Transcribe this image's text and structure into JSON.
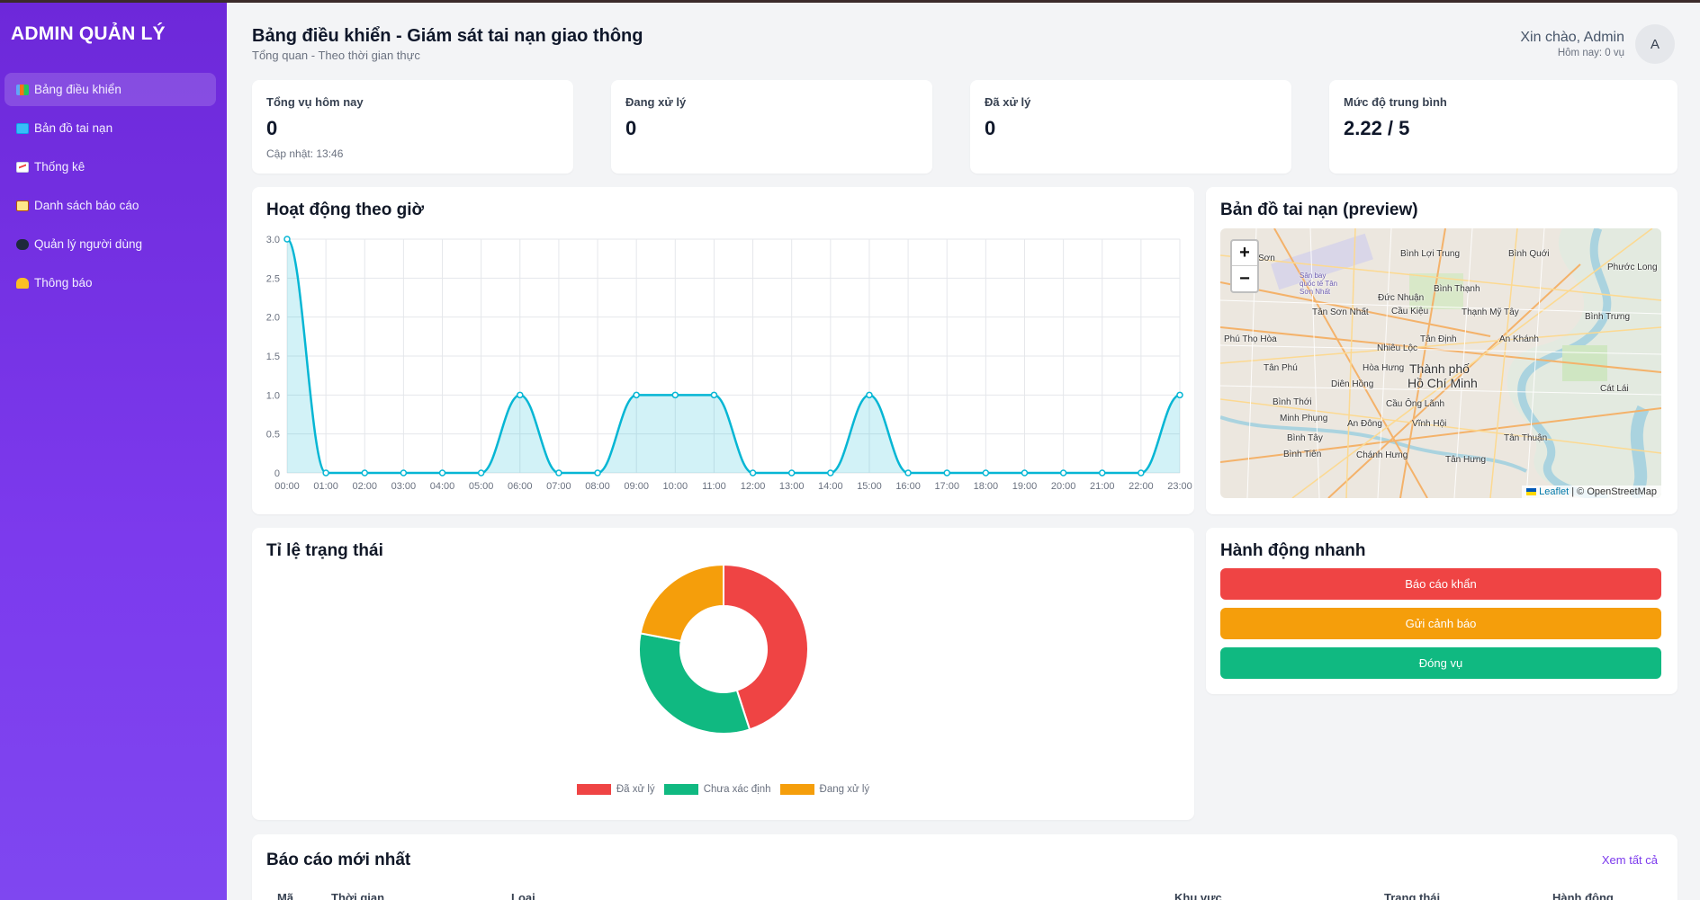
{
  "sidebar": {
    "brand": "ADMIN QUẢN LÝ",
    "items": [
      {
        "label": "Bảng điều khiển",
        "icon": "bar-chart-icon"
      },
      {
        "label": "Bản đồ tai nạn",
        "icon": "map-icon"
      },
      {
        "label": "Thống kê",
        "icon": "line-chart-icon"
      },
      {
        "label": "Danh sách báo cáo",
        "icon": "clipboard-icon"
      },
      {
        "label": "Quản lý người dùng",
        "icon": "users-icon"
      },
      {
        "label": "Thông báo",
        "icon": "bell-icon"
      }
    ],
    "active_index": 0
  },
  "header": {
    "title": "Bảng điều khiển - Giám sát tai nạn giao thông",
    "subtitle": "Tổng quan - Theo thời gian thực",
    "greeting": "Xin chào, Admin",
    "today": "Hôm nay: 0 vụ",
    "avatar_letter": "A"
  },
  "stats": [
    {
      "label": "Tổng vụ hôm nay",
      "value": "0",
      "note": "Cập nhật: 13:46"
    },
    {
      "label": "Đang xử lý",
      "value": "0",
      "note": ""
    },
    {
      "label": "Đã xử lý",
      "value": "0",
      "note": ""
    },
    {
      "label": "Mức độ trung bình",
      "value": "2.22 / 5",
      "note": ""
    }
  ],
  "activity": {
    "title": "Hoạt động theo giờ"
  },
  "status_chart": {
    "title": "Tỉ lệ trạng thái"
  },
  "map": {
    "title": "Bản đồ tai nạn (preview)",
    "zoom_in": "+",
    "zoom_out": "−",
    "attribution_leaflet": "Leaflet",
    "attribution_rest": " | © OpenStreetMap",
    "places": [
      "Tân Sơn",
      "Bình Lợi Trung",
      "Bình Quới",
      "Phước Long",
      "Sân bay quốc tế Tân Sơn Nhất",
      "Đức Nhuận",
      "Bình Thạnh",
      "Tân Sơn Nhất",
      "Cầu Kiệu",
      "Thạnh Mỹ Tây",
      "Bình Trưng",
      "Phú Thọ Hòa",
      "Nhiêu Lộc",
      "Tân Định",
      "An Khánh",
      "Tân Phú",
      "Hòa Hưng",
      "Thành phố",
      "Hồ Chí Minh",
      "Diên Hồng",
      "Cát Lái",
      "Bình Thới",
      "Minh Phụng",
      "Cầu Ông Lãnh",
      "Bình Tây",
      "An Đông",
      "Vĩnh Hội",
      "Tân Thuận",
      "Bình Tiên",
      "Chánh Hưng",
      "Tân Hưng"
    ]
  },
  "quick_actions": {
    "title": "Hành động nhanh",
    "buttons": [
      {
        "label": "Báo cáo khẩn",
        "color": "#ef4444"
      },
      {
        "label": "Gửi cảnh báo",
        "color": "#f59e0b"
      },
      {
        "label": "Đóng vụ",
        "color": "#10b981"
      }
    ]
  },
  "latest_reports": {
    "title": "Báo cáo mới nhất",
    "see_all": "Xem tất cả",
    "columns": [
      "Mã",
      "Thời gian",
      "Loại",
      "Khu vực",
      "Trạng thái",
      "Hành động"
    ]
  },
  "chart_data": [
    {
      "type": "area",
      "x": [
        "00:00",
        "01:00",
        "02:00",
        "03:00",
        "04:00",
        "05:00",
        "06:00",
        "07:00",
        "08:00",
        "09:00",
        "10:00",
        "11:00",
        "12:00",
        "13:00",
        "14:00",
        "15:00",
        "16:00",
        "17:00",
        "18:00",
        "19:00",
        "20:00",
        "21:00",
        "22:00",
        "23:00"
      ],
      "series": [
        {
          "values": [
            3,
            0,
            0,
            0,
            0,
            0,
            1,
            0,
            0,
            1,
            1,
            1,
            0,
            0,
            0,
            1,
            0,
            0,
            0,
            0,
            0,
            0,
            0,
            1
          ],
          "color": "#06b6d4"
        }
      ],
      "yticks": [
        "0",
        "0.5",
        "1.0",
        "1.5",
        "2.0",
        "2.5",
        "3.0"
      ],
      "ylim": [
        0,
        3
      ],
      "grid": true
    },
    {
      "type": "pie",
      "labels": [
        "Đã xử lý",
        "Chưa xác định",
        "Đang xử lý"
      ],
      "values": [
        45,
        33,
        22
      ],
      "colors": [
        "#ef4444",
        "#10b981",
        "#f59e0b"
      ],
      "legend": "bottom"
    }
  ]
}
